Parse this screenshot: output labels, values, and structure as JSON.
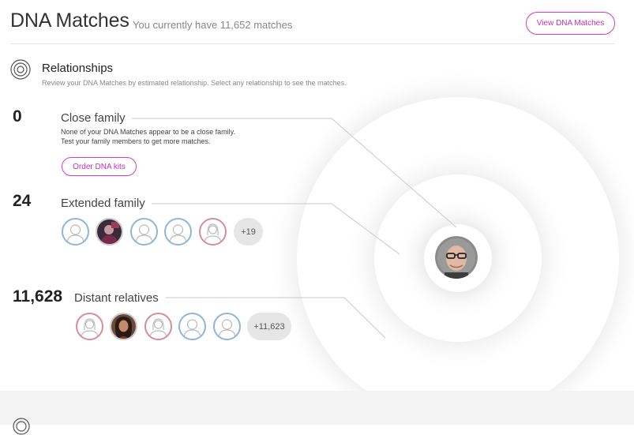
{
  "header": {
    "title": "DNA Matches",
    "subtitle": "You currently have 11,652 matches",
    "view_button": "View DNA Matches"
  },
  "relationships": {
    "title": "Relationships",
    "description": "Review your DNA Matches by estimated relationship. Select any relationship to see the matches.",
    "icon": "target-icon"
  },
  "groups": {
    "close": {
      "count": "0",
      "label": "Close family",
      "desc_line1": "None of your DNA Matches appear to be a close family.",
      "desc_line2": "Test your family members to get more matches.",
      "button": "Order DNA kits"
    },
    "extended": {
      "count": "24",
      "label": "Extended family",
      "more": "+19",
      "avatars": [
        "male-silhouette",
        "photo",
        "male-silhouette",
        "male-silhouette",
        "female-silhouette"
      ]
    },
    "distant": {
      "count": "11,628",
      "label": "Distant relatives",
      "more": "+11,623",
      "avatars": [
        "female-silhouette",
        "photo",
        "female-silhouette",
        "male-silhouette",
        "male-silhouette"
      ]
    }
  },
  "colors": {
    "accent": "#c332b4",
    "male_border": "#8fb6d6",
    "female_border": "#d98c97"
  }
}
